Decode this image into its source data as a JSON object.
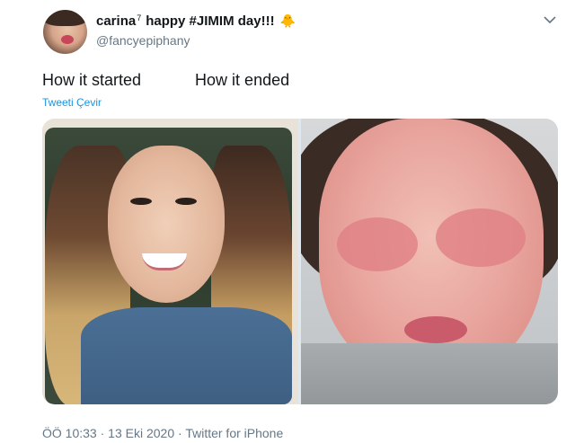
{
  "author": {
    "display_name": "carina",
    "name_superscript": "7",
    "name_suffix": "happy #JIMIM day!!!",
    "emoji": "🐥",
    "handle": "@fancyepiphany"
  },
  "tweet": {
    "text_left": "How it started",
    "text_right": "How it ended",
    "translate_label": "Tweeti Çevir"
  },
  "media": {
    "image_left_icon": "selfie-photo",
    "image_right_icon": "swollen-face-photo"
  },
  "footer": {
    "time": "ÖÖ 10:33",
    "separator1": "·",
    "date": "13 Eki 2020",
    "separator2": "·",
    "source": "Twitter for iPhone"
  },
  "colors": {
    "link": "#1b95e0",
    "secondary": "#657786",
    "text": "#14171a"
  }
}
